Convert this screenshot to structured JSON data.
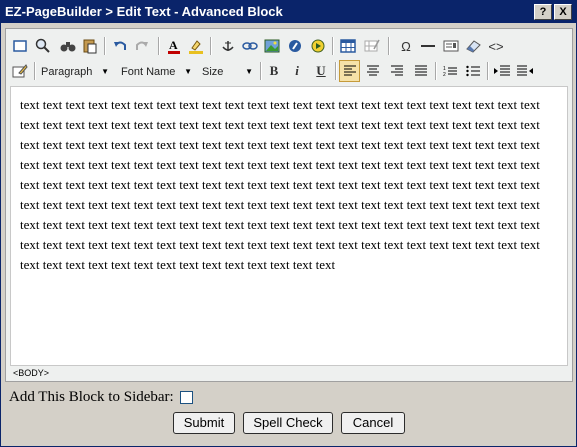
{
  "window": {
    "title": "EZ-PageBuilder > Edit Text - Advanced Block",
    "help_label": "?",
    "close_label": "X"
  },
  "toolbar": {
    "paragraph": "Paragraph",
    "font_name": "Font Name",
    "size": "Size",
    "bold": "B",
    "italic": "i",
    "underline": "U",
    "omega": "Ω",
    "code": "<>"
  },
  "editor": {
    "content": "text text text text text text text text text text text text text text text text text text text text text text text text text text text text text text text text text text text text text text text text text text text text text text text text text text text text text text text text text text text text text text text text text text text text text text text text text text text text text text text text text text text text text text text text text text text text text text text text text text text text text text text text text text text text text text text text text text text text text text text text text text text text text text text text text text text text text text text text text text text text text text text text text text text text text text text text text text text text text text text text text text text text text text text text text text text text text text text text text text text text text text text text text text text text text text text text text text text text text text",
    "status": "<BODY>"
  },
  "form": {
    "sidebar_label": "Add This Block to Sidebar:",
    "sidebar_checked": false
  },
  "buttons": {
    "submit": "Submit",
    "spell_check": "Spell Check",
    "cancel": "Cancel"
  }
}
